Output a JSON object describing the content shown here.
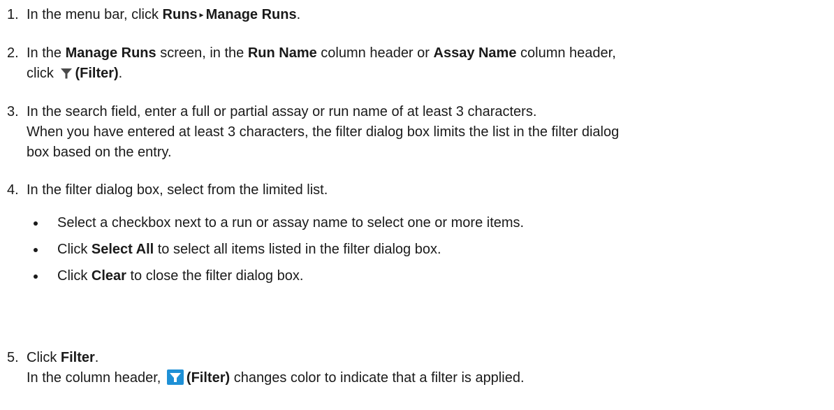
{
  "colors": {
    "text": "#1a1a1a",
    "filter_icon": "#4a4a4a",
    "filter_icon_active": "#1e90d6"
  },
  "steps": [
    {
      "number": "1.",
      "t1": "In the menu bar, click ",
      "b1": "Runs",
      "sep": "▸",
      "b2": "Manage Runs",
      "t2": "."
    },
    {
      "number": "2.",
      "t1": "In the ",
      "b1": "Manage Runs",
      "t2": " screen, in the ",
      "b2": "Run Name",
      "t3": " column header or ",
      "b3": "Assay Name",
      "t4": " column header,",
      "t5": "click ",
      "icon": "filter-icon",
      "b4": "(Filter)",
      "t6": "."
    },
    {
      "number": "3.",
      "line1": "In the search field, enter a full or partial assay or run name of at least 3 characters.",
      "line2a": "When you have entered at least 3 characters, the filter dialog box limits the list in the filter dialog",
      "line2b": "box based on the entry."
    },
    {
      "number": "4.",
      "line1": "In the filter dialog box, select from the limited list.",
      "bullets": [
        {
          "text": "Select a checkbox next to a run or assay name to select one or more items."
        },
        {
          "pre": "Click ",
          "bold": "Select All",
          "post": " to select all items listed in the filter dialog box."
        },
        {
          "pre": "Click ",
          "bold": "Clear",
          "post": " to close the filter dialog box."
        }
      ]
    },
    {
      "number": "5.",
      "t1": "Click ",
      "b1": "Filter",
      "t2": ".",
      "t3": "In the column header, ",
      "icon": "filter-active-icon",
      "b2": "(Filter)",
      "t4": " changes color to indicate that a filter is applied."
    }
  ]
}
